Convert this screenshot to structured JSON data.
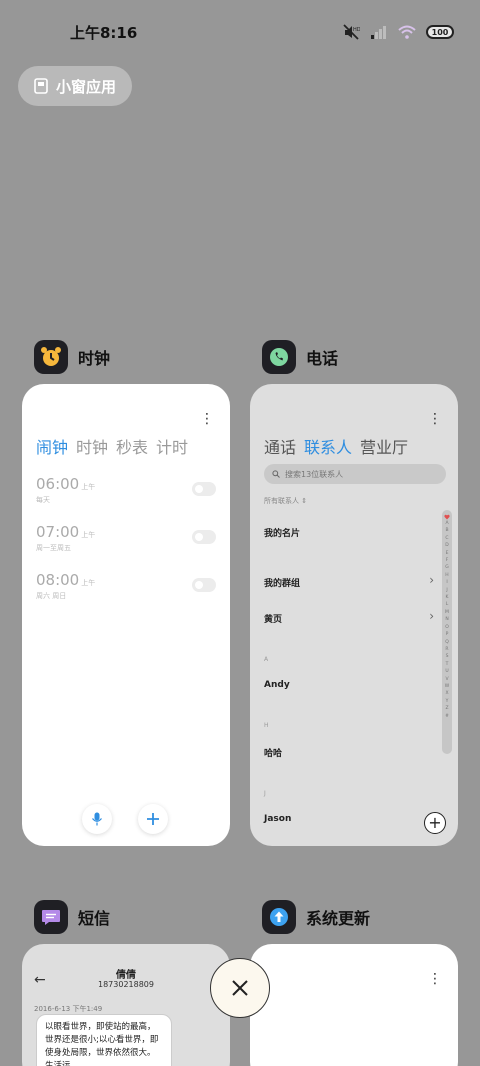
{
  "status": {
    "time": "上午8:16",
    "battery": "100"
  },
  "chip": {
    "label": "小窗应用"
  },
  "apps": {
    "clock": {
      "name": "时钟",
      "tabs": [
        "闹钟",
        "时钟",
        "秒表",
        "计时"
      ],
      "alarms": [
        {
          "time": "06:00",
          "ampm": "上午",
          "repeat": "每天"
        },
        {
          "time": "07:00",
          "ampm": "上午",
          "repeat": "周一至周五"
        },
        {
          "time": "08:00",
          "ampm": "上午",
          "repeat": "周六 周日"
        }
      ]
    },
    "phone": {
      "name": "电话",
      "tabs": [
        "通话",
        "联系人",
        "营业厅"
      ],
      "search_placeholder": "搜索13位联系人",
      "all_contacts": "所有联系人",
      "my_card": "我的名片",
      "my_groups": "我的群组",
      "yellow_pages": "黄页",
      "sections": [
        {
          "letter": "A",
          "name": "Andy"
        },
        {
          "letter": "H",
          "name": "哈哈"
        },
        {
          "letter": "J",
          "name": "Jason"
        }
      ],
      "index_letters": [
        "A",
        "B",
        "C",
        "D",
        "E",
        "F",
        "G",
        "H",
        "I",
        "J",
        "K",
        "L",
        "M",
        "N",
        "O",
        "P",
        "Q",
        "R",
        "S",
        "T",
        "U",
        "V",
        "W",
        "X",
        "Y",
        "Z",
        "#"
      ]
    },
    "sms": {
      "name": "短信",
      "contact_name": "倩倩",
      "contact_number": "18730218809",
      "date": "2016-6-13 下午1:49",
      "message": "以眼看世界，即使站的最高，世界还是很小;以心看世界，即使身处局限，世界依然很大。生活远"
    },
    "update": {
      "name": "系统更新"
    }
  },
  "colors": {
    "background": "#979797",
    "accent": "#2f8ee0"
  }
}
